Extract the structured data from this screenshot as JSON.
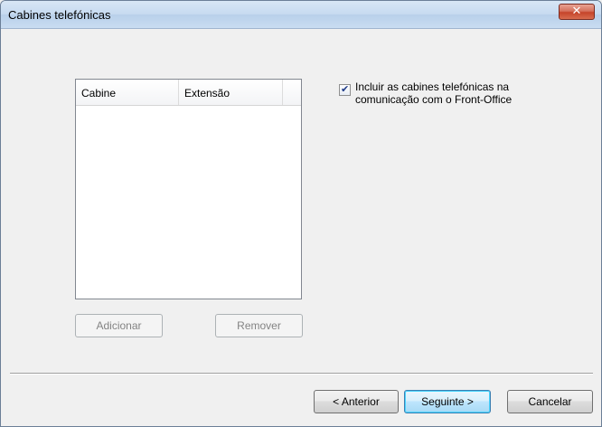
{
  "window": {
    "title": "Cabines telefónicas",
    "close_symbol": "✕"
  },
  "list": {
    "columns": [
      "Cabine",
      "Extensão"
    ],
    "rows": []
  },
  "list_buttons": {
    "add": "Adicionar",
    "remove": "Remover"
  },
  "option": {
    "checked": true,
    "label": "Incluir as cabines telefónicas na comunicação com o Front-Office"
  },
  "footer": {
    "back": "< Anterior",
    "next": "Seguinte >",
    "cancel": "Cancelar"
  }
}
